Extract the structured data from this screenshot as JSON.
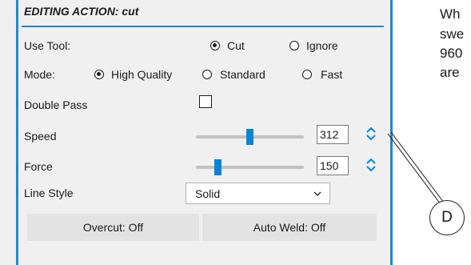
{
  "panel": {
    "title": "EDITING ACTION: cut",
    "use_tool": {
      "label": "Use Tool:",
      "options": [
        "Cut",
        "Ignore"
      ],
      "selected": "Cut"
    },
    "mode": {
      "label": "Mode:",
      "options": [
        "High Quality",
        "Standard",
        "Fast"
      ],
      "selected": "High Quality"
    },
    "double_pass": {
      "label": "Double Pass",
      "checked": false
    },
    "speed": {
      "label": "Speed",
      "value": "312",
      "slider_fraction": 0.5
    },
    "force": {
      "label": "Force",
      "value": "150",
      "slider_fraction": 0.18
    },
    "line_style": {
      "label": "Line Style",
      "value": "Solid"
    },
    "buttons": {
      "overcut": "Overcut: Off",
      "auto_weld": "Auto Weld: Off"
    }
  },
  "callout": {
    "text_lines": [
      "Wh",
      "swe",
      "960",
      "are"
    ],
    "marker": "D"
  },
  "colors": {
    "accent": "#1a8ad4",
    "slider_thumb": "#0a84d6",
    "panel_bg": "#f0f0f0",
    "button_bg": "#e3e3e3"
  },
  "icons": {
    "spinner": "spinner-updown-icon",
    "dropdown": "chevron-down-icon"
  }
}
